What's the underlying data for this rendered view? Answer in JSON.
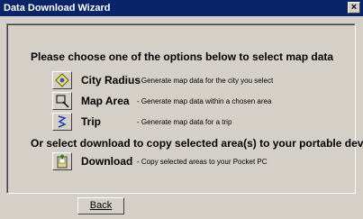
{
  "window": {
    "title": "Data Download Wizard",
    "close_label": "×"
  },
  "panel": {
    "heading1": "Please choose one of the options below to select map data",
    "options": [
      {
        "label": "City Radius",
        "desc": "- Generate map data for the city you select",
        "icon": "city-radius-icon"
      },
      {
        "label": "Map Area",
        "desc": "- Generate map data within a chosen area",
        "icon": "map-area-icon"
      },
      {
        "label": "Trip",
        "desc": "- Generate map data for a trip",
        "icon": "trip-icon"
      }
    ],
    "heading2": "Or select download to copy selected area(s) to your portable device",
    "download": {
      "label": "Download",
      "desc": "- Copy selected areas to your Pocket PC",
      "icon": "download-device-icon"
    }
  },
  "footer": {
    "back_label": "Back"
  }
}
